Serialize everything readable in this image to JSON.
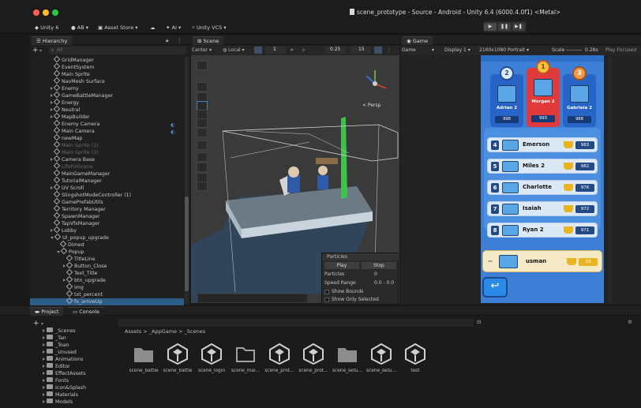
{
  "window": {
    "title": "scene_prototype - Source - Android - Unity 6.4 (6000.4.0f1) <Metal>"
  },
  "toolbar": {
    "unity_label": "Unity 6",
    "account": "AB",
    "asset_store": "Asset Store",
    "ai": "AI",
    "vcs": "Unity VCS"
  },
  "play_controls": {
    "play": "▶",
    "pause": "❚❚",
    "step": "▶❚"
  },
  "hierarchy": {
    "tab": "Hierarchy",
    "search_placeholder": "All",
    "items": [
      "GridManager",
      "EventSystem",
      "Main Sprite",
      "NavMesh Surface",
      "Enemy",
      "GameBattleManager",
      "Energy",
      "Neutral",
      "MapBuilder",
      "Enemy Camera",
      "Main Camera",
      "newMap",
      "Main Sprite (1)",
      "Main Sprite (3)",
      "Camera Base",
      "LifeFolScene",
      "MainGameManager",
      "TutorialManager",
      "UV Scroll",
      "SlingshotModeController (1)",
      "GamePrefabUtils",
      "Territory Manager",
      "SpawnManager",
      "TapVfxManager",
      "Lobby",
      "UI_popup_upgrade",
      "Dimed",
      "Popup",
      "TitleLine",
      "Button_Close",
      "Text_Title",
      "btn_upgrade",
      "img",
      "txt_percent",
      "fx_arrowUp"
    ]
  },
  "scene": {
    "tab": "Scene",
    "pivot": "Center",
    "space": "Local",
    "grid_snap": "1",
    "snap_value": "0.25",
    "camera_value": "15",
    "persp_label": "< Persp"
  },
  "particles": {
    "header": "Particles",
    "play": "Play",
    "stop": "Stop",
    "rows": [
      {
        "label": "Particles",
        "value": "0"
      },
      {
        "label": "Speed Range",
        "value": "0.0 - 0.0"
      }
    ],
    "show_bounds": "Show Bounds",
    "show_only_selected": "Show Only Selected"
  },
  "game": {
    "tab": "Game",
    "display_mode": "Game",
    "display": "Display 1",
    "resolution": "2160x1080 Portrait",
    "scale_label": "Scale",
    "scale_value": "0.28x",
    "play_focused": "Play Focused",
    "podium": [
      {
        "rank": "2",
        "name": "Adrian 2",
        "score": "998",
        "color": "#2864c7"
      },
      {
        "rank": "1",
        "name": "Morgan 2",
        "score": "993",
        "color": "#e03a3a"
      },
      {
        "rank": "3",
        "name": "Gabriela 2",
        "score": "988",
        "color": "#2864c7"
      }
    ],
    "leaderboard": [
      {
        "rank": "4",
        "name": "Emerson",
        "score": "983"
      },
      {
        "rank": "5",
        "name": "Miles 2",
        "score": "982"
      },
      {
        "rank": "6",
        "name": "Charlotte",
        "score": "976"
      },
      {
        "rank": "7",
        "name": "Isaiah",
        "score": "972"
      },
      {
        "rank": "8",
        "name": "Ryan 2",
        "score": "971"
      }
    ],
    "self": {
      "rank": "--",
      "name": "usman",
      "score": "33"
    }
  },
  "project": {
    "tab_project": "Project",
    "tab_console": "Console",
    "breadcrumb": [
      "Assets",
      "_AppGame",
      "_Scenes"
    ],
    "tree": [
      "_Scenes",
      "_Tan",
      "_Toan",
      "_Unused",
      "Animations",
      "Editor",
      "EffectAssets",
      "Fonts",
      "Icon&Splash",
      "Materials",
      "Models"
    ],
    "assets": [
      {
        "name": "scene_battle",
        "kind": "folder"
      },
      {
        "name": "scene_battle",
        "kind": "unity"
      },
      {
        "name": "scene_login",
        "kind": "unity"
      },
      {
        "name": "scene_mai...",
        "kind": "folder-outline"
      },
      {
        "name": "scene_prot...",
        "kind": "unity"
      },
      {
        "name": "scene_prot...",
        "kind": "unity"
      },
      {
        "name": "scene_setu...",
        "kind": "folder"
      },
      {
        "name": "scene_setu...",
        "kind": "unity"
      },
      {
        "name": "test",
        "kind": "unity"
      }
    ]
  },
  "colors": {
    "accent": "#2c5d87",
    "phone_bg": "#3d7fd6",
    "gold": "#e9b321"
  }
}
